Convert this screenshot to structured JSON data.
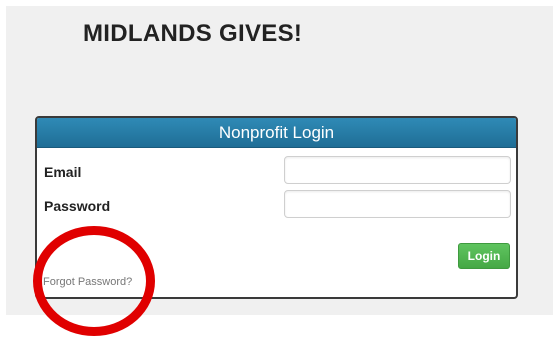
{
  "header": {
    "site_title": "MIDLANDS GIVES!"
  },
  "login_panel": {
    "title": "Nonprofit Login",
    "email_label": "Email",
    "email_value": "",
    "password_label": "Password",
    "password_value": "",
    "login_button_label": "Login",
    "forgot_password_link": "Forgot Password?"
  },
  "colors": {
    "panel_header": "#2f8ab6",
    "login_button": "#5fc45f",
    "annotation_circle": "#e00000"
  }
}
